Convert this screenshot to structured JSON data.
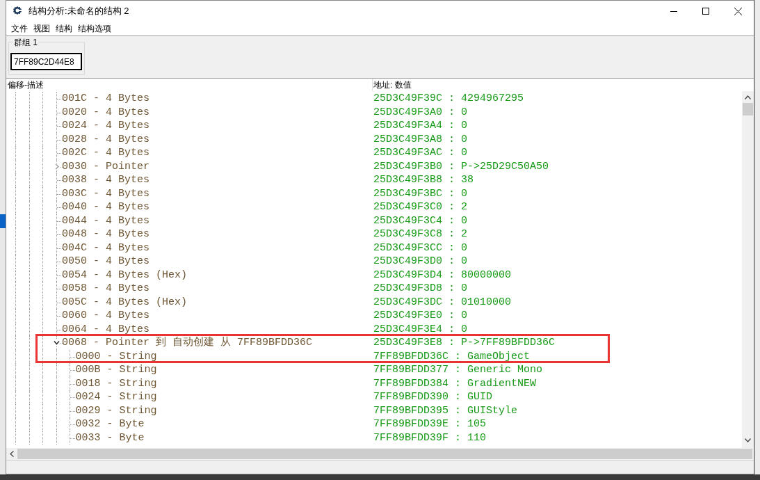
{
  "window": {
    "title": "结构分析:未命名的结构 2"
  },
  "menu": [
    "文件",
    "视图",
    "结构",
    "结构选项"
  ],
  "group": {
    "label": "群组 1",
    "address": "7FF89C2D44E8"
  },
  "columns": [
    "偏移-描述",
    "地址: 数值"
  ],
  "rows": [
    {
      "kind": "value",
      "offset_description": "001C - 4 Bytes",
      "address_value": "25D3C49F39C : 4294967295"
    },
    {
      "kind": "value",
      "offset_description": "0020 - 4 Bytes",
      "address_value": "25D3C49F3A0 : 0"
    },
    {
      "kind": "value",
      "offset_description": "0024 - 4 Bytes",
      "address_value": "25D3C49F3A4 : 0"
    },
    {
      "kind": "value",
      "offset_description": "0028 - 4 Bytes",
      "address_value": "25D3C49F3A8 : 0"
    },
    {
      "kind": "value",
      "offset_description": "002C - 4 Bytes",
      "address_value": "25D3C49F3AC : 0"
    },
    {
      "kind": "pointer",
      "expanded": false,
      "offset_description": "0030 - Pointer",
      "address_value": "25D3C49F3B0 : P->25D29C50A50"
    },
    {
      "kind": "value",
      "offset_description": "0038 - 4 Bytes",
      "address_value": "25D3C49F3B8 : 38"
    },
    {
      "kind": "value",
      "offset_description": "003C - 4 Bytes",
      "address_value": "25D3C49F3BC : 0"
    },
    {
      "kind": "value",
      "offset_description": "0040 - 4 Bytes",
      "address_value": "25D3C49F3C0 : 2"
    },
    {
      "kind": "value",
      "offset_description": "0044 - 4 Bytes",
      "address_value": "25D3C49F3C4 : 0"
    },
    {
      "kind": "value",
      "offset_description": "0048 - 4 Bytes",
      "address_value": "25D3C49F3C8 : 2"
    },
    {
      "kind": "value",
      "offset_description": "004C - 4 Bytes",
      "address_value": "25D3C49F3CC : 0"
    },
    {
      "kind": "value",
      "offset_description": "0050 - 4 Bytes",
      "address_value": "25D3C49F3D0 : 0"
    },
    {
      "kind": "value",
      "offset_description": "0054 - 4 Bytes (Hex)",
      "address_value": "25D3C49F3D4 : 80000000"
    },
    {
      "kind": "value",
      "offset_description": "0058 - 4 Bytes",
      "address_value": "25D3C49F3D8 : 0"
    },
    {
      "kind": "value",
      "offset_description": "005C - 4 Bytes (Hex)",
      "address_value": "25D3C49F3DC : 01010000"
    },
    {
      "kind": "value",
      "offset_description": "0060 - 4 Bytes",
      "address_value": "25D3C49F3E0 : 0"
    },
    {
      "kind": "value",
      "offset_description": "0064 - 4 Bytes",
      "address_value": "25D3C49F3E4 : 0"
    },
    {
      "kind": "pointer",
      "expanded": true,
      "offset_description": "0068 - Pointer 到 自动创建 从 7FF89BFDD36C",
      "address_value": "25D3C49F3E8 : P->7FF89BFDD36C",
      "children": [
        {
          "kind": "value",
          "offset_description": "0000 - String",
          "address_value": "7FF89BFDD36C : GameObject"
        },
        {
          "kind": "value",
          "offset_description": "000B - String",
          "address_value": "7FF89BFDD377 : Generic Mono"
        },
        {
          "kind": "value",
          "offset_description": "0018 - String",
          "address_value": "7FF89BFDD384 : GradientNEW"
        },
        {
          "kind": "value",
          "offset_description": "0024 - String",
          "address_value": "7FF89BFDD390 : GUID"
        },
        {
          "kind": "value",
          "offset_description": "0029 - String",
          "address_value": "7FF89BFDD395 : GUIStyle"
        },
        {
          "kind": "value",
          "offset_description": "0032 - Byte",
          "address_value": "7FF89BFDD39E : 105"
        },
        {
          "kind": "value",
          "offset_description": "0033 - Byte",
          "address_value": "7FF89BFDD39F : 110"
        }
      ]
    }
  ]
}
